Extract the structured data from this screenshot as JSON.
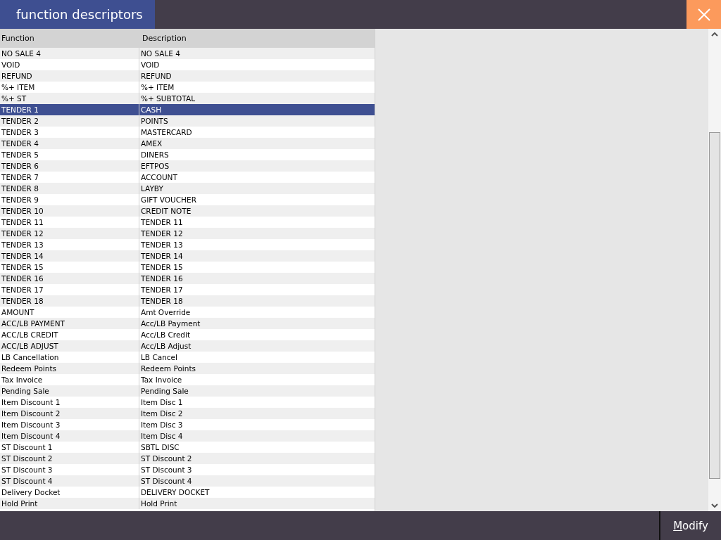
{
  "window": {
    "title": "function descriptors"
  },
  "table": {
    "columns": [
      "Function",
      "Description"
    ],
    "rows": [
      {
        "cells": [
          "NO SALE 4",
          "NO SALE 4"
        ],
        "selected": false
      },
      {
        "cells": [
          "VOID",
          "VOID"
        ],
        "selected": false
      },
      {
        "cells": [
          "REFUND",
          "REFUND"
        ],
        "selected": false
      },
      {
        "cells": [
          "%+ ITEM",
          "%+ ITEM"
        ],
        "selected": false
      },
      {
        "cells": [
          "%+ ST",
          "%+ SUBTOTAL"
        ],
        "selected": false
      },
      {
        "cells": [
          "TENDER 1",
          "CASH"
        ],
        "selected": true
      },
      {
        "cells": [
          "TENDER 2",
          "POINTS"
        ],
        "selected": false
      },
      {
        "cells": [
          "TENDER 3",
          "MASTERCARD"
        ],
        "selected": false
      },
      {
        "cells": [
          "TENDER 4",
          "AMEX"
        ],
        "selected": false
      },
      {
        "cells": [
          "TENDER 5",
          "DINERS"
        ],
        "selected": false
      },
      {
        "cells": [
          "TENDER 6",
          "EFTPOS"
        ],
        "selected": false
      },
      {
        "cells": [
          "TENDER 7",
          "ACCOUNT"
        ],
        "selected": false
      },
      {
        "cells": [
          "TENDER 8",
          "LAYBY"
        ],
        "selected": false
      },
      {
        "cells": [
          "TENDER 9",
          "GIFT VOUCHER"
        ],
        "selected": false
      },
      {
        "cells": [
          "TENDER 10",
          "CREDIT NOTE"
        ],
        "selected": false
      },
      {
        "cells": [
          "TENDER 11",
          "TENDER 11"
        ],
        "selected": false
      },
      {
        "cells": [
          "TENDER 12",
          "TENDER 12"
        ],
        "selected": false
      },
      {
        "cells": [
          "TENDER 13",
          "TENDER 13"
        ],
        "selected": false
      },
      {
        "cells": [
          "TENDER 14",
          "TENDER 14"
        ],
        "selected": false
      },
      {
        "cells": [
          "TENDER 15",
          "TENDER 15"
        ],
        "selected": false
      },
      {
        "cells": [
          "TENDER 16",
          "TENDER 16"
        ],
        "selected": false
      },
      {
        "cells": [
          "TENDER 17",
          "TENDER 17"
        ],
        "selected": false
      },
      {
        "cells": [
          "TENDER 18",
          "TENDER 18"
        ],
        "selected": false
      },
      {
        "cells": [
          "AMOUNT",
          "Amt Override"
        ],
        "selected": false
      },
      {
        "cells": [
          "ACC/LB PAYMENT",
          "Acc/LB Payment"
        ],
        "selected": false
      },
      {
        "cells": [
          "ACC/LB CREDIT",
          "Acc/LB Credit"
        ],
        "selected": false
      },
      {
        "cells": [
          "ACC/LB ADJUST",
          "Acc/LB Adjust"
        ],
        "selected": false
      },
      {
        "cells": [
          "LB Cancellation",
          "LB Cancel"
        ],
        "selected": false
      },
      {
        "cells": [
          "Redeem Points",
          "Redeem Points"
        ],
        "selected": false
      },
      {
        "cells": [
          "Tax Invoice",
          "Tax Invoice"
        ],
        "selected": false
      },
      {
        "cells": [
          "Pending Sale",
          "Pending Sale"
        ],
        "selected": false
      },
      {
        "cells": [
          "Item Discount 1",
          "Item Disc 1"
        ],
        "selected": false
      },
      {
        "cells": [
          "Item Discount 2",
          "Item Disc 2"
        ],
        "selected": false
      },
      {
        "cells": [
          "Item Discount 3",
          "Item Disc 3"
        ],
        "selected": false
      },
      {
        "cells": [
          "Item Discount 4",
          "Item Disc 4"
        ],
        "selected": false
      },
      {
        "cells": [
          "ST Discount 1",
          "SBTL DISC"
        ],
        "selected": false
      },
      {
        "cells": [
          "ST Discount 2",
          "ST Discount 2"
        ],
        "selected": false
      },
      {
        "cells": [
          "ST Discount 3",
          "ST Discount 3"
        ],
        "selected": false
      },
      {
        "cells": [
          "ST Discount 4",
          "ST Discount 4"
        ],
        "selected": false
      },
      {
        "cells": [
          "Delivery Docket",
          "DELIVERY DOCKET"
        ],
        "selected": false
      },
      {
        "cells": [
          "Hold Print",
          "Hold Print"
        ],
        "selected": false
      }
    ]
  },
  "buttons": [
    {
      "label": "Modify"
    }
  ]
}
